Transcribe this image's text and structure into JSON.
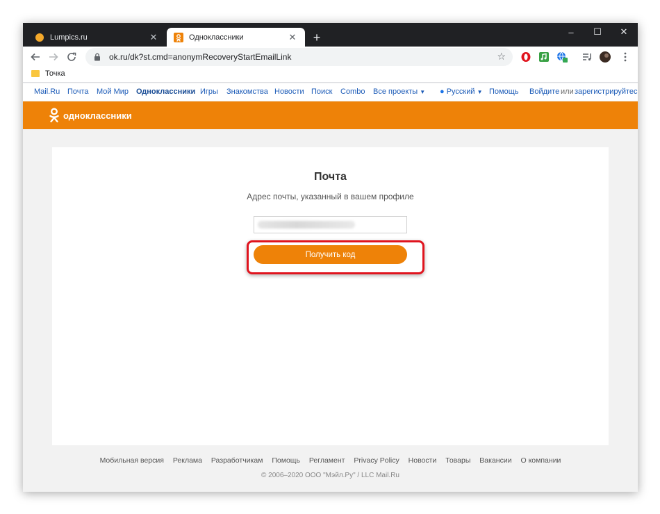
{
  "tabs": [
    {
      "title": "Lumpics.ru",
      "active": false
    },
    {
      "title": "Одноклассники",
      "active": true
    }
  ],
  "window_controls": {
    "minimize": "–",
    "maximize": "☐",
    "close": "✕"
  },
  "address": {
    "url": "ok.ru/dk?st.cmd=anonymRecoveryStartEmailLink"
  },
  "bookmarks": [
    {
      "label": "Точка"
    }
  ],
  "portal": {
    "links": [
      "Mail.Ru",
      "Почта",
      "Мой Мир",
      "Одноклассники",
      "Игры",
      "Знакомства",
      "Новости",
      "Поиск",
      "Combo",
      "Все проекты"
    ],
    "language": "Русский",
    "help": "Помощь",
    "login": "Войдите",
    "or": "или",
    "register": "зарегистрируйтесь"
  },
  "brand": {
    "name": "одноклассники",
    "color": "#ee8208"
  },
  "card": {
    "title": "Почта",
    "subtitle": "Адрес почты, указанный в вашем профиле",
    "email_value": "",
    "button_label": "Получить код"
  },
  "footer": {
    "links": [
      "Мобильная версия",
      "Реклама",
      "Разработчикам",
      "Помощь",
      "Регламент",
      "Privacy Policy",
      "Новости",
      "Товары",
      "Вакансии",
      "О компании"
    ],
    "copyright": "© 2006–2020 ООО \"Мэйл.Ру\" / LLC Mail.Ru"
  },
  "icons": {
    "back": "arrow-left-icon",
    "forward": "arrow-right-icon",
    "reload": "reload-icon",
    "lock": "lock-icon",
    "star": "star-icon"
  }
}
